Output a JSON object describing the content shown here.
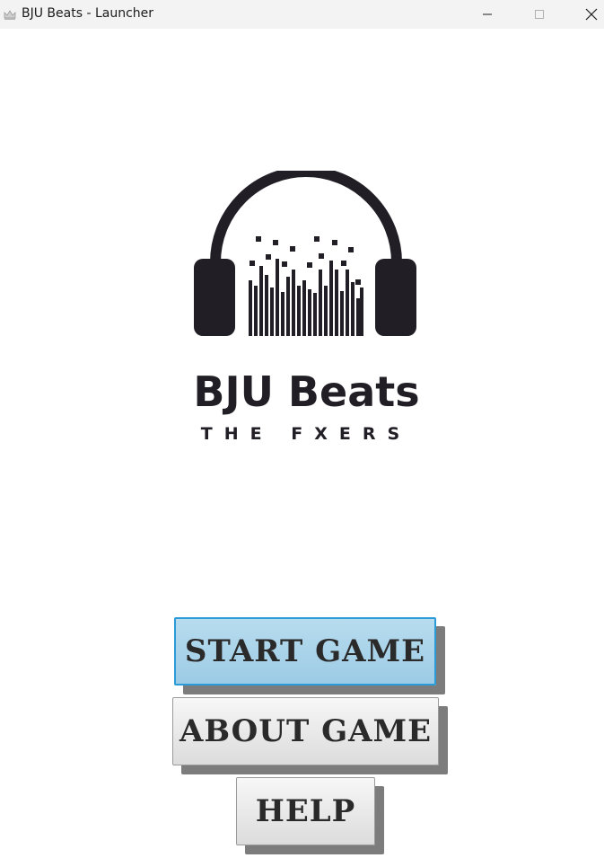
{
  "window": {
    "title": "BJU Beats - Launcher",
    "app_icon": "crown-icon",
    "controls": {
      "minimize_icon": "minimize-icon",
      "maximize_icon": "maximize-icon",
      "close_icon": "close-icon"
    }
  },
  "logo": {
    "icon": "headphones-equalizer-icon",
    "brand_name": "BJU Beats",
    "tagline": "THE FXERS"
  },
  "menu": {
    "start_label": "START GAME",
    "about_label": "ABOUT GAME",
    "help_label": "HELP"
  },
  "colors": {
    "logo_dark": "#221e26",
    "start_button_bg": "#a9d3ea",
    "start_button_border": "#2a9bd6",
    "button_bg": "#e8e8e8",
    "titlebar_bg": "#f3f3f3"
  }
}
